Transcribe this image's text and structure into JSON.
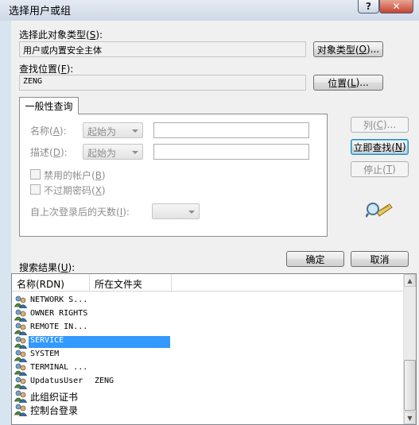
{
  "window": {
    "title": "选择用户或组",
    "help_glyph": "?",
    "close_glyph": "✕"
  },
  "object_type": {
    "label": "选择此对象类型(",
    "key": "S",
    "label_end": "):",
    "value": "用户或内置安全主体",
    "button": "对象类型(",
    "button_key": "O",
    "button_end": ")..."
  },
  "location": {
    "label": "查找位置(",
    "key": "F",
    "label_end": "):",
    "value": "ZENG",
    "button": "位置(",
    "button_key": "L",
    "button_end": ")..."
  },
  "tab": {
    "label": "一般性查询"
  },
  "query": {
    "name_label": "名称(",
    "name_key": "A",
    "name_end": "):",
    "name_combo": "起始为",
    "desc_label": "描述(",
    "desc_key": "D",
    "desc_end": "):",
    "desc_combo": "起始为",
    "disabled_accounts": "禁用的帐户(",
    "disabled_key": "B",
    "disabled_end": ")",
    "no_expire": "不过期密码(",
    "no_expire_key": "X",
    "no_expire_end": ")",
    "days_label": "自上次登录后的天数(",
    "days_key": "I",
    "days_end": "):"
  },
  "buttons": {
    "columns": "列(",
    "columns_key": "C",
    "columns_end": ")...",
    "find_now": "立即查找(",
    "find_now_key": "N",
    "find_now_end": ")",
    "stop": "停止(",
    "stop_key": "T",
    "stop_end": ")",
    "ok": "确定",
    "cancel": "取消"
  },
  "results": {
    "label": "搜索结果(",
    "key": "U",
    "label_end": "):",
    "columns": [
      "名称(RDN)",
      "所在文件夹"
    ],
    "rows": [
      {
        "name": "NETWORK S...",
        "folder": ""
      },
      {
        "name": "OWNER RIGHTS",
        "folder": ""
      },
      {
        "name": "REMOTE IN...",
        "folder": ""
      },
      {
        "name": "SERVICE",
        "folder": "",
        "selected": true
      },
      {
        "name": "SYSTEM",
        "folder": ""
      },
      {
        "name": "TERMINAL ...",
        "folder": ""
      },
      {
        "name": "UpdatusUser",
        "folder": "ZENG"
      },
      {
        "name": "此组织证书",
        "folder": ""
      },
      {
        "name": "控制台登录",
        "folder": ""
      }
    ]
  },
  "icons": {
    "user_group": "users-icon",
    "find": "magnifier-icon"
  }
}
